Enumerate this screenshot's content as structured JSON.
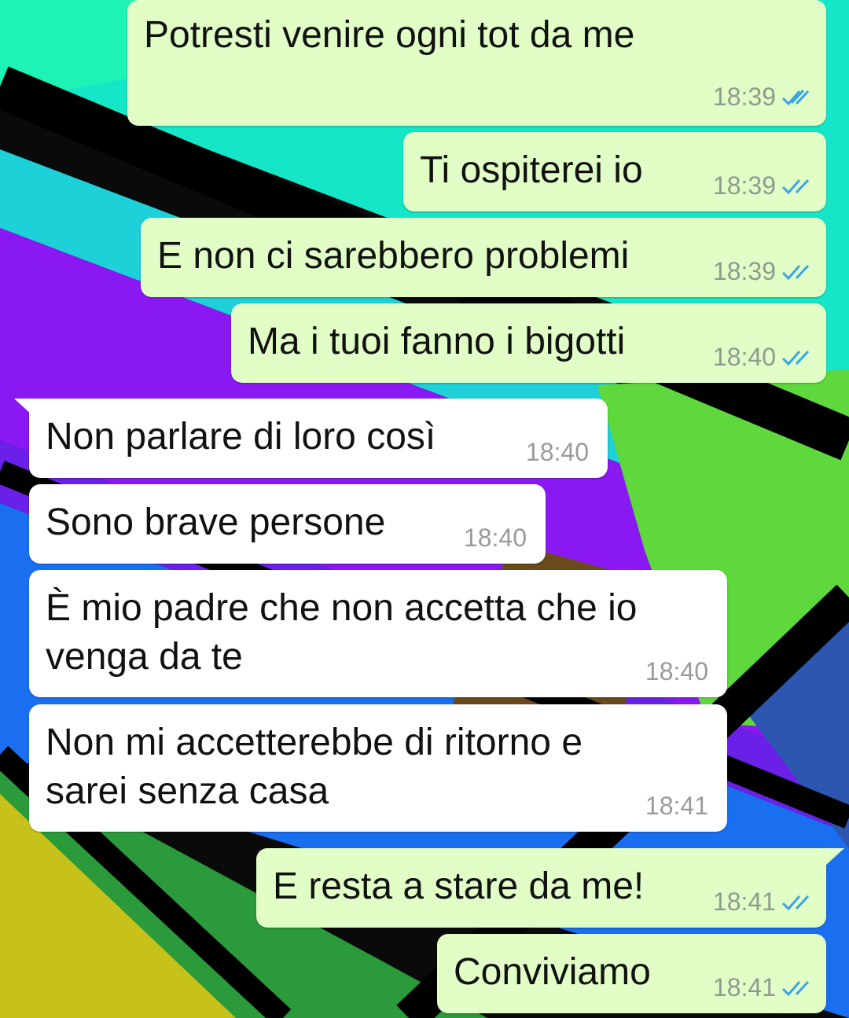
{
  "messages": [
    {
      "dir": "out",
      "text": "Potresti venire ogni tot da me",
      "time": "18:39",
      "status": "read"
    },
    {
      "dir": "out",
      "text": "Ti ospiterei io",
      "time": "18:39",
      "status": "read"
    },
    {
      "dir": "out",
      "text": "E non ci sarebbero problemi",
      "time": "18:39",
      "status": "read"
    },
    {
      "dir": "out",
      "text": "Ma i tuoi fanno i bigotti",
      "time": "18:40",
      "status": "read"
    },
    {
      "dir": "in",
      "text": "Non parlare di loro così",
      "time": "18:40"
    },
    {
      "dir": "in",
      "text": "Sono brave persone",
      "time": "18:40"
    },
    {
      "dir": "in",
      "text_lines": [
        "È mio padre che non accetta che io",
        "venga da te"
      ],
      "time": "18:40"
    },
    {
      "dir": "in",
      "text_lines": [
        "Non mi accetterebbe di ritorno e",
        "sarei senza casa"
      ],
      "time": "18:41"
    },
    {
      "dir": "out",
      "text": "E resta a stare da me!",
      "time": "18:41",
      "status": "read"
    },
    {
      "dir": "out",
      "text": "Conviviamo",
      "time": "18:41",
      "status": "read"
    }
  ],
  "colors": {
    "outgoing_bubble": "#e1fec6",
    "incoming_bubble": "#ffffff",
    "read_ticks": "#3ba3e6",
    "timestamp": "#8e9a8f"
  },
  "icons": {
    "read_receipt": "double-check-icon"
  }
}
